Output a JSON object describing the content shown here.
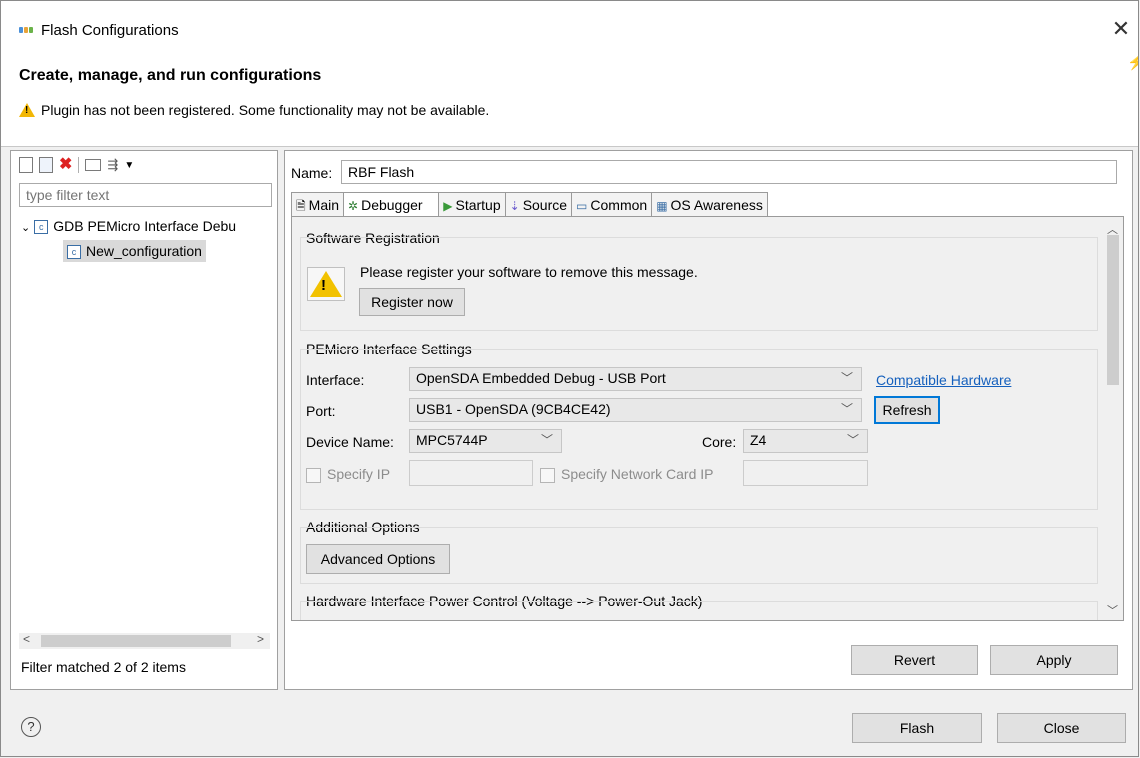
{
  "window": {
    "title": "Flash Configurations",
    "close_glyph": "✕",
    "heading": "Create, manage, and run configurations",
    "warning": "Plugin has not been registered. Some functionality may not be available.",
    "accent_color": "#0078d7"
  },
  "left": {
    "filter_placeholder": "type filter text",
    "tree": [
      {
        "label": "GDB PEMicro Interface Debu",
        "expanded": true
      },
      {
        "label": "New_configuration",
        "selected": true
      }
    ],
    "status": "Filter matched 2 of 2 items"
  },
  "right": {
    "name_label": "Name:",
    "name_value": "RBF Flash",
    "tabs": [
      {
        "label": "Main",
        "icon": "document-icon"
      },
      {
        "label": "Debugger",
        "icon": "bug-icon",
        "active": true
      },
      {
        "label": "Startup",
        "icon": "play-icon"
      },
      {
        "label": "Source",
        "icon": "source-icon"
      },
      {
        "label": "Common",
        "icon": "common-icon"
      },
      {
        "label": "OS Awareness",
        "icon": "os-icon"
      }
    ],
    "software_registration": {
      "title": "Software Registration",
      "message": "Please register your software to remove this message.",
      "button": "Register now"
    },
    "pemicro": {
      "title": "PEMicro Interface Settings",
      "interface_label": "Interface:",
      "interface_value": "OpenSDA Embedded Debug - USB Port",
      "compatible_link": "Compatible Hardware",
      "port_label": "Port:",
      "port_value": "USB1 - OpenSDA (9CB4CE42)",
      "refresh": "Refresh",
      "device_label": "Device Name:",
      "device_value": "MPC5744P",
      "core_label": "Core:",
      "core_value": "Z4",
      "specify_ip": "Specify IP",
      "specify_nic": "Specify Network Card IP"
    },
    "additional": {
      "title": "Additional Options",
      "button": "Advanced Options"
    },
    "power": {
      "title": "Hardware Interface Power Control (Voltage --> Power-Out Jack)"
    },
    "revert": "Revert",
    "apply": "Apply"
  },
  "footer": {
    "help": "?",
    "flash": "Flash",
    "close": "Close"
  }
}
